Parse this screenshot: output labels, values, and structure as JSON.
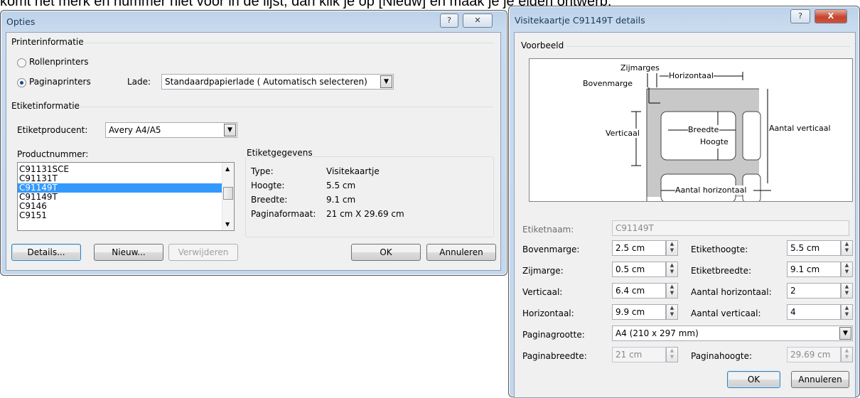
{
  "background_text": "komt het merk en nummer niet voor in de lijst, dan klik je op [Nieuw] en maak je je eigen ontwerp.",
  "opties": {
    "title": "Opties",
    "help": "?",
    "close": "✕",
    "printerinfo": "Printerinformatie",
    "rollen": "Rollenprinters",
    "pagina": "Paginaprinters",
    "lade_label": "Lade:",
    "lade_value": "Standaardpapierlade ( Automatisch selecteren)",
    "etiketinfo": "Etiketinformatie",
    "producent_label": "Etiketproducent:",
    "producent_value": "Avery A4/A5",
    "productnummer_label": "Productnummer:",
    "products": [
      "C91131SCE",
      "C91131T",
      "C91149T",
      "C91149T",
      "C9146",
      "C9151"
    ],
    "selected_index": 2,
    "gegevens": "Etiketgegevens",
    "type_l": "Type:",
    "type_v": "Visitekaartje",
    "hoogte_l": "Hoogte:",
    "hoogte_v": "5.5 cm",
    "breedte_l": "Breedte:",
    "breedte_v": "9.1 cm",
    "formaat_l": "Paginaformaat:",
    "formaat_v": "21 cm X 29.69 cm",
    "details": "Details...",
    "nieuw": "Nieuw...",
    "verwijderen": "Verwijderen",
    "ok": "OK",
    "annuleren": "Annuleren"
  },
  "details": {
    "title": "Visitekaartje C91149T details",
    "help": "?",
    "close": "X",
    "voorbeeld": "Voorbeeld",
    "preview": {
      "zijmarges": "Zijmarges",
      "horizontaal": "Horizontaal",
      "bovenmarge": "Bovenmarge",
      "aantal_verticaal": "Aantal verticaal",
      "verticaal": "Verticaal",
      "breedte": "Breedte",
      "hoogte": "Hoogte",
      "aantal_horizontaal": "Aantal horizontaal"
    },
    "etiketnaam_l": "Etiketnaam:",
    "etiketnaam_v": "C91149T",
    "bovenmarge_l": "Bovenmarge:",
    "bovenmarge_v": "2.5 cm",
    "zijmarge_l": "Zijmarge:",
    "zijmarge_v": "0.5 cm",
    "verticaal_l": "Verticaal:",
    "verticaal_v": "6.4 cm",
    "horizontaal_l": "Horizontaal:",
    "horizontaal_v": "9.9 cm",
    "ethoogte_l": "Etikethoogte:",
    "ethoogte_v": "5.5 cm",
    "etbreedte_l": "Etiketbreedte:",
    "etbreedte_v": "9.1 cm",
    "aanthor_l": "Aantal horizontaal:",
    "aanthor_v": "2",
    "aantver_l": "Aantal verticaal:",
    "aantver_v": "4",
    "paginagrootte_l": "Paginagrootte:",
    "paginagrootte_v": "A4 (210 x 297 mm)",
    "paginabreedte_l": "Paginabreedte:",
    "paginabreedte_v": "21 cm",
    "paginahoogte_l": "Paginahoogte:",
    "paginahoogte_v": "29.69 cm",
    "ok": "OK",
    "annuleren": "Annuleren"
  }
}
